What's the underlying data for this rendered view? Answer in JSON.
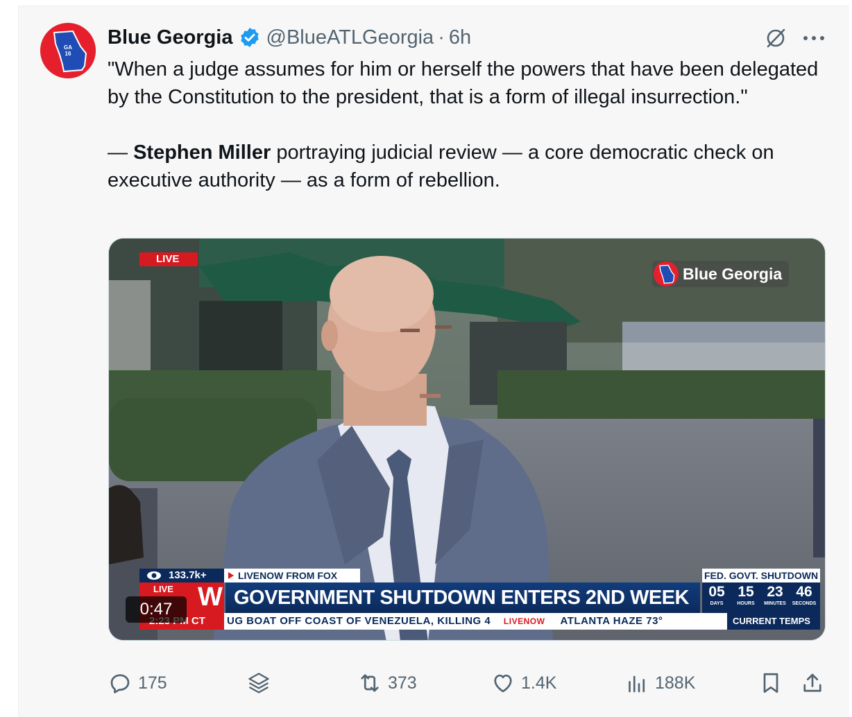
{
  "tweet": {
    "author_name": "Blue Georgia",
    "handle": "@BlueATLGeorgia",
    "separator": "·",
    "time": "6h",
    "verified": true,
    "avatar_text": "GA 16",
    "text_quote": "\"When a judge assumes for him or herself the powers that have been delegated by the Constitution to the president, that is a form of illegal insurrection.\"",
    "attribution_dash": "— ",
    "attribution_name": "Stephen Miller",
    "attribution_rest": " portraying judicial review — a core democratic check on executive authority — as a form of rebellion."
  },
  "header_icons": [
    "grok-icon",
    "more-icon"
  ],
  "video": {
    "duration": "0:47",
    "live_tag": "LIVE",
    "watermark": "Blue Georgia",
    "views": "133.7k+",
    "source": "LIVENOW FROM FOX",
    "logo_small": "LIVE",
    "logo_big": "W",
    "headline": "GOVERNMENT SHUTDOWN ENTERS 2ND WEEK",
    "fed_label": "FED. GOVT. SHUTDOWN",
    "countdown": [
      {
        "value": "05",
        "label": "DAYS"
      },
      {
        "value": "15",
        "label": "HOURS"
      },
      {
        "value": "23",
        "label": "MINUTES"
      },
      {
        "value": "46",
        "label": "SECONDS"
      }
    ],
    "ticker_time": "2:23 PM CT",
    "ticker_text": "UG BOAT OFF COAST OF VENEZUELA, KILLING 4",
    "ticker_brand": "LIVENOW",
    "ticker_weather": "ATLANTA   HAZE 73°",
    "ticker_temps": "CURRENT TEMPS"
  },
  "actions": {
    "replies": "175",
    "retweets": "373",
    "likes": "1.4K",
    "views": "188K"
  },
  "colors": {
    "background": "#f7f7f7",
    "text_primary": "#0f1419",
    "text_secondary": "#536471",
    "verified_blue": "#1d9bf0",
    "news_navy": "#0b2a5b",
    "news_red": "#d71920"
  }
}
